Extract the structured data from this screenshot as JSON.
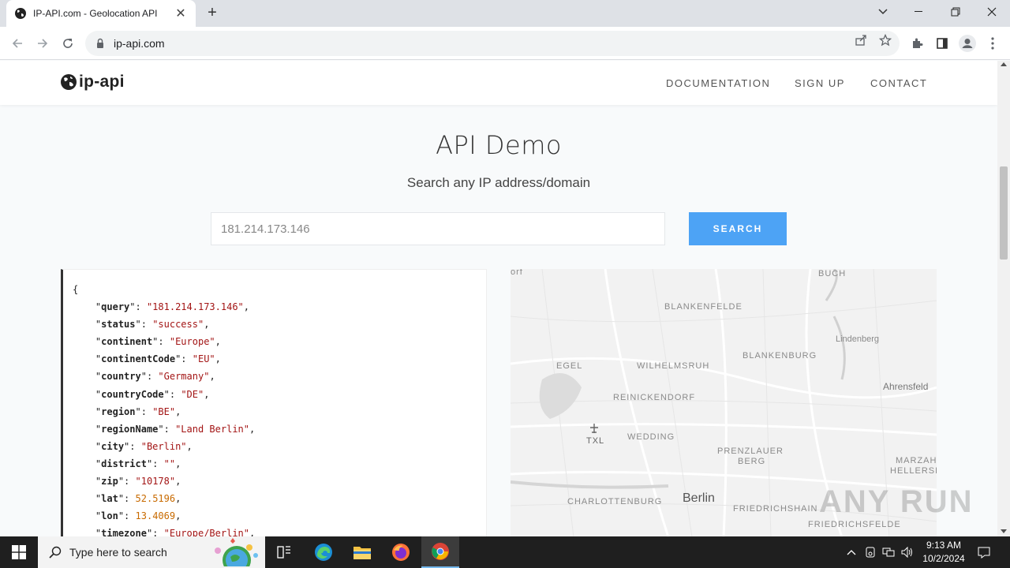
{
  "browser": {
    "tab_title": "IP-API.com - Geolocation API",
    "tab_close": "✕",
    "new_tab": "+",
    "url": "ip-api.com"
  },
  "site": {
    "logo_text": "ip-api",
    "nav": [
      "DOCUMENTATION",
      "SIGN UP",
      "CONTACT"
    ],
    "heading": "API Demo",
    "subheading": "Search any IP address/domain",
    "input_value": "181.214.173.146",
    "search_label": "SEARCH"
  },
  "json_result": [
    {
      "key": "query",
      "value": "\"181.214.173.146\"",
      "type": "string"
    },
    {
      "key": "status",
      "value": "\"success\"",
      "type": "string"
    },
    {
      "key": "continent",
      "value": "\"Europe\"",
      "type": "string"
    },
    {
      "key": "continentCode",
      "value": "\"EU\"",
      "type": "string"
    },
    {
      "key": "country",
      "value": "\"Germany\"",
      "type": "string"
    },
    {
      "key": "countryCode",
      "value": "\"DE\"",
      "type": "string"
    },
    {
      "key": "region",
      "value": "\"BE\"",
      "type": "string"
    },
    {
      "key": "regionName",
      "value": "\"Land Berlin\"",
      "type": "string"
    },
    {
      "key": "city",
      "value": "\"Berlin\"",
      "type": "string"
    },
    {
      "key": "district",
      "value": "\"\"",
      "type": "string"
    },
    {
      "key": "zip",
      "value": "\"10178\"",
      "type": "string"
    },
    {
      "key": "lat",
      "value": "52.5196",
      "type": "number"
    },
    {
      "key": "lon",
      "value": "13.4069",
      "type": "number"
    },
    {
      "key": "timezone",
      "value": "\"Europe/Berlin\"",
      "type": "string"
    }
  ],
  "json_open": "{",
  "map": {
    "labels": [
      "orf",
      "BUCH",
      "BLANKENFELDE",
      "Lindenberg",
      "EGEL",
      "WILHELMSRUH",
      "BLANKENBURG",
      "Ahrensfeld",
      "REINICKENDORF",
      "TXL",
      "WEDDING",
      "PRENZLAUER",
      "BERG",
      "MARZAHN-",
      "HELLERSDO",
      "CHARLOTTENBURG",
      "Berlin",
      "FRIEDRICHSHAIN",
      "FRIEDRICHSFELDE"
    ],
    "watermark": "ANY RUN"
  },
  "taskbar": {
    "search_placeholder": "Type here to search",
    "time": "9:13 AM",
    "date": "10/2/2024"
  },
  "colors": {
    "accent": "#4da3f5",
    "json_string": "#a31515",
    "json_number": "#c86a00"
  }
}
